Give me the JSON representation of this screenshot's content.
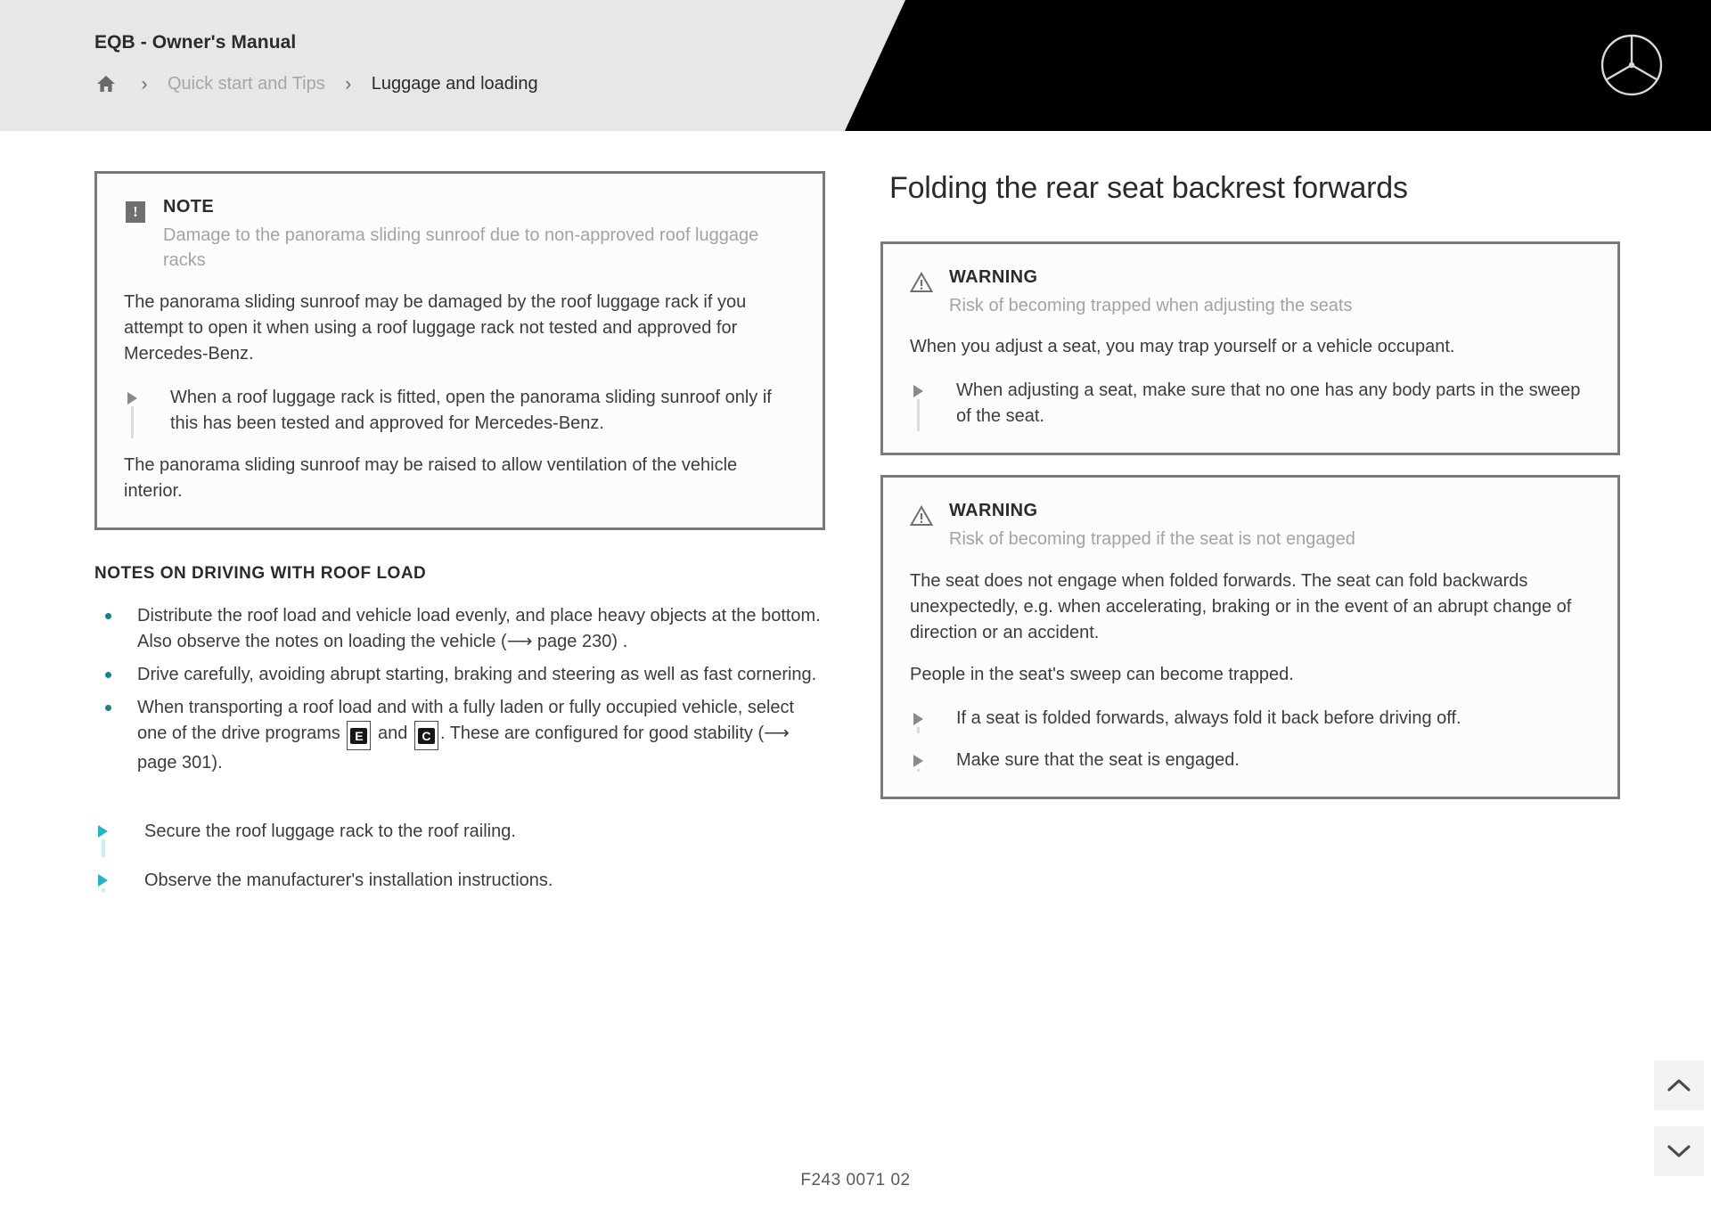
{
  "header": {
    "manual_title": "EQB - Owner's Manual",
    "breadcrumb": {
      "home_icon": "home-icon",
      "separator": "›",
      "parent": "Quick start and Tips",
      "current": "Luggage and loading"
    },
    "logo": "mercedes-benz-star-logo",
    "background": "#e7e7e7",
    "banner_color": "#000000"
  },
  "left_column": {
    "note_box": {
      "icon": "exclamation-note-icon",
      "label": "NOTE",
      "subtitle": "Damage to the panorama sliding sunroof due to non-approved roof luggage racks",
      "paragraph_1": "The panorama sliding sunroof may be damaged by the roof luggage rack if you attempt to open it when using a roof luggage rack not tested and approved for Mercedes-Benz.",
      "actions": [
        "When a roof luggage rack is fitted, open the panorama sliding sunroof only if this has been tested and approved for Mercedes-Benz."
      ],
      "paragraph_2": "The panorama sliding sunroof may be raised to allow ventilation of the vehicle interior."
    },
    "section_title": "NOTES ON DRIVING WITH ROOF LOAD",
    "bullets": [
      {
        "part_1": "Distribute the roof load and vehicle load evenly, and place heavy objects at the bottom. Also observe the notes on loading the vehicle (⟶ page 230) .",
        "has_icons": false
      },
      {
        "part_1": "Drive carefully, avoiding abrupt starting, braking and steering as well as fast cornering.",
        "has_icons": false
      },
      {
        "part_1": "When transporting a roof load and with a fully laden or fully occupied vehicle, select one of the drive programs ",
        "icon_1": "E",
        "middle": " and ",
        "icon_2": "C",
        "part_2": ". These are configured for good stability (⟶ page 301).",
        "has_icons": true
      }
    ],
    "teal_actions": [
      "Secure the roof luggage rack to the roof railing.",
      "Observe the manufacturer's installation instructions."
    ]
  },
  "right_column": {
    "heading": "Folding the rear seat backrest forwards",
    "warnings": [
      {
        "icon": "warning-triangle-icon",
        "label": "WARNING",
        "subtitle": "Risk of becoming trapped when adjusting the seats",
        "paragraphs": [
          "When you adjust a seat, you may trap yourself or a vehicle occupant."
        ],
        "actions": [
          "When adjusting a seat, make sure that no one has any body parts in the sweep of the seat."
        ]
      },
      {
        "icon": "warning-triangle-icon",
        "label": "WARNING",
        "subtitle": "Risk of becoming trapped if the seat is not engaged",
        "paragraphs": [
          "The seat does not engage when folded forwards. The seat can fold backwards unexpectedly, e.g. when accelerating, braking or in the event of an abrupt change of direction or an accident.",
          "People in the seat's sweep can become trapped."
        ],
        "actions": [
          "If a seat is folded forwards, always fold it back before driving off.",
          "Make sure that the seat is engaged."
        ]
      }
    ]
  },
  "controls": {
    "scroll_up": "chevron-up-icon",
    "scroll_down": "chevron-down-icon"
  },
  "footer": {
    "document_code": "F243 0071 02"
  },
  "colors": {
    "accent_teal": "#23b5c6",
    "bullet_teal": "#1a7f83",
    "box_border": "#7a7a7a",
    "muted_text": "#a3a3a3"
  }
}
